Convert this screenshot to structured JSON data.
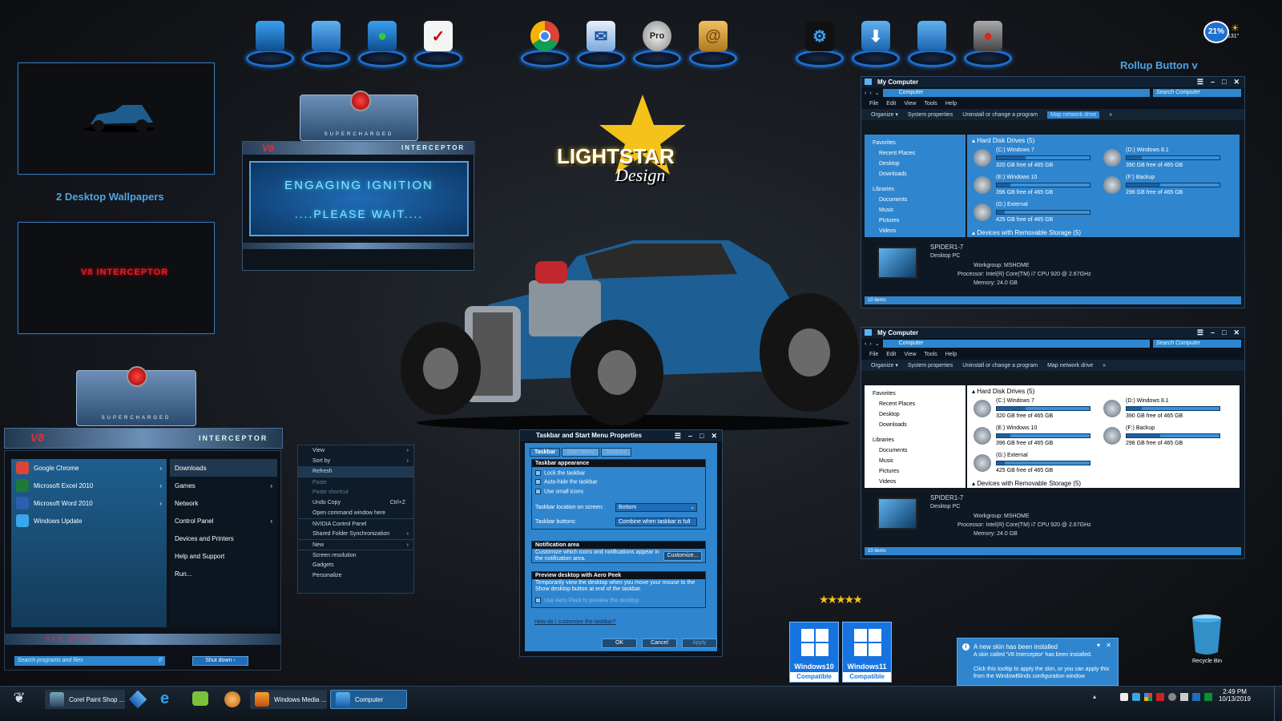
{
  "wallpapers": {
    "label": "2 Desktop Wallpapers",
    "thumb2_text": "V8 INTERCEPTOR"
  },
  "rollup": "Rollup Button v",
  "weather": {
    "percent": "21%",
    "temp": "131°"
  },
  "logo": {
    "line1": "LIGHTSTAR",
    "line2": "Design"
  },
  "splash": {
    "badge": "V8",
    "brand": "INTERCEPTOR",
    "sub": "SUPERCHARGED",
    "line1": "ENGAGING IGNITION",
    "line2": "....PLEASE WAIT...."
  },
  "dock": {
    "pro_label": "Pro"
  },
  "explorer": {
    "title": "My Computer",
    "address": "Computer",
    "search": "Search Computer",
    "menu": [
      "File",
      "Edit",
      "View",
      "Tools",
      "Help"
    ],
    "commands": [
      "Organize ▾",
      "System properties",
      "Uninstall or change a program",
      "Map network drive",
      "»"
    ],
    "nav": [
      "Favorites",
      "Recent Places",
      "Desktop",
      "Downloads",
      "Libraries",
      "Documents",
      "Music",
      "Pictures",
      "Videos"
    ],
    "group_hdd": "Hard Disk Drives (5)",
    "group_removable": "Devices with Removable Storage (5)",
    "drives": [
      {
        "name": "(C:) Windows 7",
        "free": "320 GB free of 465 GB",
        "used": 0.31
      },
      {
        "name": "(D:) Windows 8.1",
        "free": "390 GB free of 465 GB",
        "used": 0.16
      },
      {
        "name": "(E:) Windows 10",
        "free": "396 GB free of 465 GB",
        "used": 0.15
      },
      {
        "name": "(F:) Backup",
        "free": "298 GB free of 465 GB",
        "used": 0.36
      },
      {
        "name": "(G:) External",
        "free": "425 GB free of 465 GB",
        "used": 0.09
      }
    ],
    "pc_name": "SPIDER1-7",
    "pc_type": "Desktop PC",
    "workgroup": "Workgroup:  MSHOME",
    "processor": "Processor:  Intel(R) Core(TM) i7 CPU       920  @ 2.67GHz",
    "memory": "Memory:  24.0 GB",
    "status": "10 items"
  },
  "startmenu": {
    "badge": "V8",
    "brand": "INTERCEPTOR",
    "sub": "SUPERCHARGED",
    "left": [
      "Google Chrome",
      "Microsoft Excel 2010",
      "Microsoft Word 2010",
      "Windows Update"
    ],
    "right": [
      "Downloads",
      "Games",
      "Network",
      "Control Panel",
      "Devices and Printers",
      "Help and Support",
      "Run..."
    ],
    "sys_apps": "SYS APPS",
    "search": "Search programs and files",
    "shutdown": "Shut down"
  },
  "context": {
    "items": [
      "View",
      "Sort by",
      "Refresh",
      "Paste",
      "Paste shortcut",
      "Undo Copy",
      "Open command window here",
      "NVIDIA Control Panel",
      "Shared Folder Synchronization",
      "New",
      "Screen resolution",
      "Gadgets",
      "Personalize"
    ],
    "undo_shortcut": "Ctrl+Z"
  },
  "dialog": {
    "title": "Taskbar and Start Menu Properties",
    "tabs": [
      "Taskbar",
      "Start Menu",
      "Toolbars"
    ],
    "sec1": "Taskbar appearance",
    "checks": [
      "Lock the taskbar",
      "Auto-hide the taskbar",
      "Use small icons"
    ],
    "loc_label": "Taskbar location on screen:",
    "loc_value": "Bottom",
    "btn_label": "Taskbar buttons:",
    "btn_value": "Combine when taskbar is full",
    "sec2": "Notification area",
    "notif_text": "Customize which icons and notifications appear in the notification area.",
    "customize": "Customize...",
    "sec3": "Preview desktop with Aero Peek",
    "peek_text": "Temporarily view the desktop when you move your mouse to the Show desktop button at end of the taskbar.",
    "peek_check": "Use Aero Peek to preview the desktop",
    "link": "How do I customize the taskbar?",
    "ok": "OK",
    "cancel": "Cancel",
    "apply": "Apply"
  },
  "badges": {
    "w10": "Windows10",
    "w11": "Windows11",
    "cap": "Compatible"
  },
  "recycle": "Recycle Bin",
  "notification": {
    "title": "A new skin has been installed",
    "body1": "A skin called 'V8 Interceptor' has been installed.",
    "body2": "Click this tooltip to apply the skin, or you can apply this from the WindowBlinds configuration window"
  },
  "taskbar": {
    "buttons": [
      "Corel Paint Shop ...",
      "Windows Media ...",
      "Computer"
    ],
    "time": "2:49 PM",
    "date": "10/13/2019"
  }
}
